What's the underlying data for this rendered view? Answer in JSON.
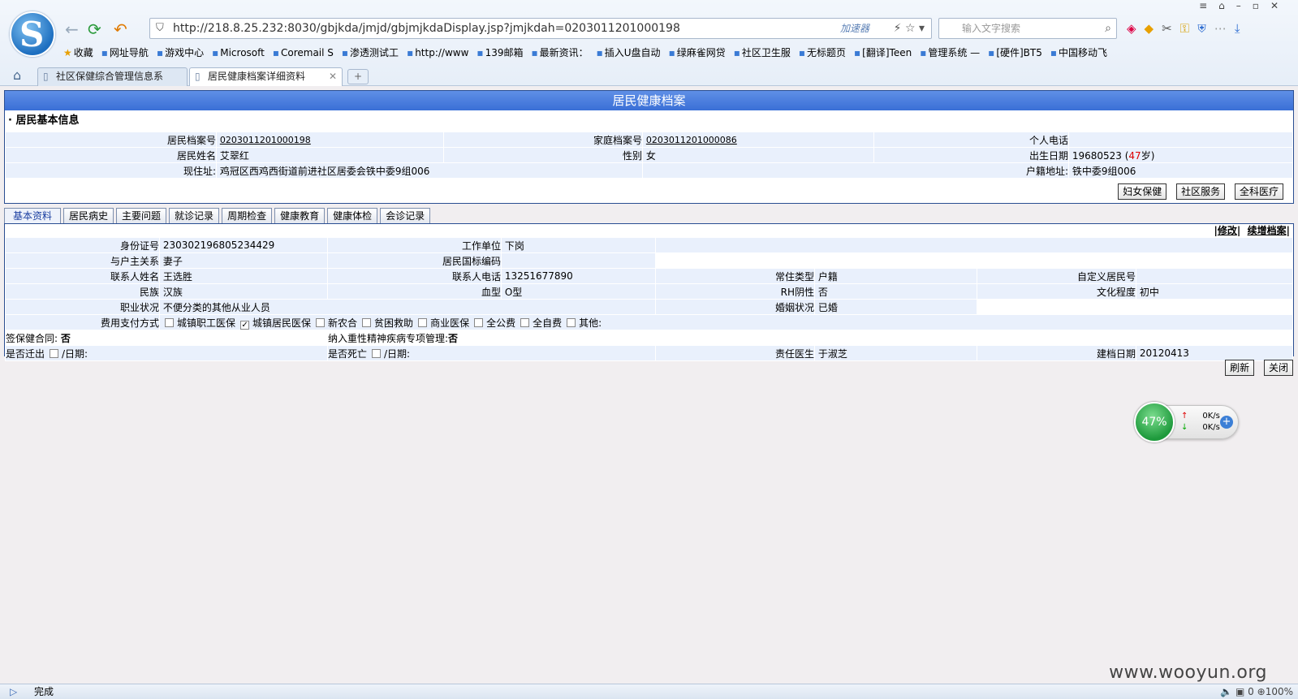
{
  "browser": {
    "url": "http://218.8.25.232:8030/gbjkda/jmjd/gbjmjkdaDisplay.jsp?jmjkdah=0203011201000198",
    "accelerator": "加速器",
    "search_placeholder": "输入文字搜索",
    "bookmarks": [
      "收藏",
      "网址导航",
      "游戏中心",
      "Microsoft",
      "Coremail S",
      "渗透测试工",
      "http://www",
      "139邮箱",
      "最新资讯：",
      "插入U盘自动",
      "绿麻雀网贷",
      "社区卫生服",
      "无标题页",
      "[翻译]Teen",
      "管理系统 —",
      "[硬件]BT5",
      "中国移动飞"
    ],
    "tabs": [
      {
        "label": "社区保健综合管理信息系"
      },
      {
        "label": "居民健康档案详细资料"
      }
    ],
    "status_text": "完成",
    "zoom": "100%",
    "status_count": "0"
  },
  "page": {
    "banner_title": "居民健康档案",
    "section_title": "· 居民基本信息",
    "info": {
      "record_no_label": "居民档案号",
      "record_no": "0203011201000198",
      "family_no_label": "家庭档案号",
      "family_no": "0203011201000086",
      "phone_label": "个人电话",
      "name_label": "居民姓名",
      "name": "艾翠红",
      "gender_label": "性别",
      "gender": "女",
      "birth_label": "出生日期",
      "birth": "19680523",
      "age_prefix": "(",
      "age": "47",
      "age_suffix": "岁)",
      "address_label": "现住址:",
      "address": "鸡冠区西鸡西街道前进社区居委会铁中委9组006",
      "household_label": "户籍地址:",
      "household": "铁中委9组006"
    },
    "top_buttons": [
      "妇女保健",
      "社区服务",
      "全科医疗"
    ],
    "subtabs": [
      "基本资料",
      "居民病史",
      "主要问题",
      "就诊记录",
      "周期检查",
      "健康教育",
      "健康体检",
      "会诊记录"
    ],
    "actions": {
      "edit": "修改",
      "continue": "续增档案"
    },
    "basic": {
      "id_label": "身份证号",
      "id": "230302196805234429",
      "work_label": "工作单位",
      "work": "下岗",
      "relation_label": "与户主关系",
      "relation": "妻子",
      "intl_code_label": "居民国标编码",
      "contact_name_label": "联系人姓名",
      "contact_name": "王选胜",
      "contact_phone_label": "联系人电话",
      "contact_phone": "13251677890",
      "residence_type_label": "常住类型",
      "residence_type": "户籍",
      "custom_no_label": "自定义居民号",
      "ethnic_label": "民族",
      "ethnic": "汉族",
      "blood_label": "血型",
      "blood": "O型",
      "rh_label": "RH阴性",
      "rh": "否",
      "edu_label": "文化程度",
      "edu": "初中",
      "job_label": "职业状况",
      "job": "不便分类的其他从业人员",
      "marital_label": "婚姻状况",
      "marital": "已婚",
      "payment_label": "费用支付方式",
      "payment_options": [
        {
          "label": "城镇职工医保",
          "checked": false
        },
        {
          "label": "城镇居民医保",
          "checked": true
        },
        {
          "label": "新农合",
          "checked": false
        },
        {
          "label": "贫困救助",
          "checked": false
        },
        {
          "label": "商业医保",
          "checked": false
        },
        {
          "label": "全公费",
          "checked": false
        },
        {
          "label": "全自费",
          "checked": false
        },
        {
          "label": "其他:",
          "checked": false
        }
      ],
      "contract_label": "签保健合同:",
      "contract": "否",
      "mental_label": "纳入重性精神疾病专项管理:",
      "mental": "否",
      "moved_label": "是否迁出",
      "moved_date_label": "/日期:",
      "dead_label": "是否死亡",
      "dead_date_label": "/日期:",
      "doctor_label": "责任医生",
      "doctor": "于淑芝",
      "created_label": "建档日期",
      "created": "20120413"
    },
    "bottom_buttons": [
      "刷新",
      "关闭"
    ]
  },
  "speed_widget": {
    "percent": "47%",
    "up": "0K/s",
    "down": "0K/s"
  },
  "watermark": "www.wooyun.org"
}
